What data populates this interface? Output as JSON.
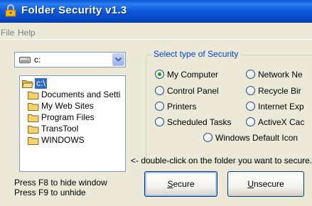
{
  "window": {
    "title": "Folder Security v1.3"
  },
  "menu": [
    "File",
    "Help"
  ],
  "drive": {
    "selected": "c:"
  },
  "folders": [
    {
      "label": "c:\\",
      "selected": true,
      "open": true
    },
    {
      "label": "Documents and Setti"
    },
    {
      "label": "My Web Sites"
    },
    {
      "label": "Program Files"
    },
    {
      "label": "TransTool"
    },
    {
      "label": "WINDOWS"
    }
  ],
  "hints": [
    "Press F8 to hide window",
    "Press F9 to unhide"
  ],
  "security": {
    "group_title": "Select type of Security",
    "options": [
      {
        "label": "My Computer",
        "checked": true
      },
      {
        "label": "Network Ne"
      },
      {
        "label": "Control Panel"
      },
      {
        "label": "Recycle Bir"
      },
      {
        "label": "Printers"
      },
      {
        "label": "Internet Exp"
      },
      {
        "label": "Scheduled Tasks"
      },
      {
        "label": "ActiveX Cac"
      },
      {
        "label": "Windows Default Icon"
      }
    ]
  },
  "instruction": "<- double-click on the folder you want to secure...",
  "buttons": {
    "secure_accel": "S",
    "secure_rest": "ecure",
    "unsecure_accel": "U",
    "unsecure_rest": "nsecure"
  },
  "colors": {
    "titlebar": "#0b58d8",
    "selection": "#316ac5",
    "group_title": "#0046d5",
    "radio_dot": "#2a9a1a"
  }
}
